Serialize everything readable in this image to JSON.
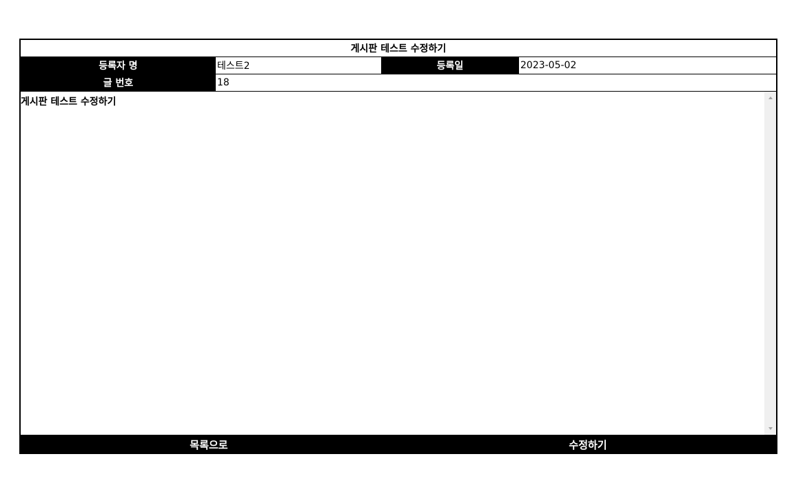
{
  "board": {
    "title": "게시판 테스트 수정하기",
    "author_label": "등록자 명",
    "author_value": "테스트2",
    "date_label": "등록일",
    "date_value": "2023-05-02",
    "number_label": "글 번호",
    "number_value": "18",
    "content": "게시판 테스트 수정하기"
  },
  "buttons": {
    "list_label": "목록으로",
    "edit_label": "수정하기"
  }
}
